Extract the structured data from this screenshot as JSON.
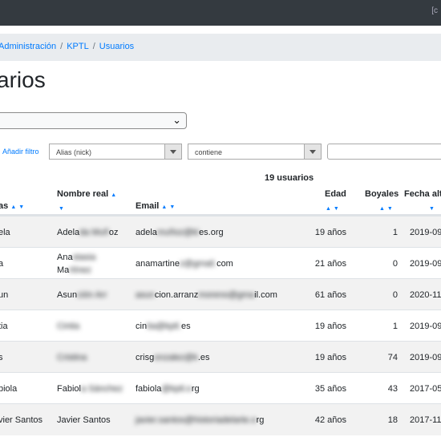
{
  "topbar": {
    "tray_text": "[c"
  },
  "breadcrumb": {
    "items": [
      "Administración",
      "KPTL",
      "Usuarios"
    ],
    "separator": "/"
  },
  "page": {
    "title": "arios"
  },
  "filters": {
    "add_filter_label": "Añadir filtro",
    "field_select": "Alias (nick)",
    "operator_select": "contiene",
    "value_input": ""
  },
  "results": {
    "count_label": "19 usuarios"
  },
  "table": {
    "headers": {
      "alias": "as",
      "nombre": "Nombre real",
      "email": "Email",
      "edad": "Edad",
      "boyales": "Boyales",
      "fecha": "Fecha alt"
    },
    "rows": [
      {
        "alias": "ela",
        "nombre": "Adela",
        "nombre2": "",
        "email": "adela",
        "email_end": "es.org",
        "edad": "19 años",
        "boyales": "1",
        "fecha": "2019-09"
      },
      {
        "alias": "a",
        "nombre": "Ana",
        "nombre2": "Ma",
        "email": "anamartine",
        "email_end": "com",
        "edad": "21 años",
        "boyales": "0",
        "fecha": "2019-09"
      },
      {
        "alias": "un",
        "nombre": "Asun",
        "nombre2": "",
        "email": "",
        "email_end": "il.com",
        "edad": "61 años",
        "boyales": "0",
        "fecha": "2020-11"
      },
      {
        "alias": "tia",
        "nombre": "",
        "nombre2": "",
        "email": "cin",
        "email_end": "es",
        "edad": "19 años",
        "boyales": "1",
        "fecha": "2019-09"
      },
      {
        "alias": "s",
        "nombre": "",
        "nombre2": "",
        "email": "crisg",
        "email_end": ".es",
        "edad": "19 años",
        "boyales": "74",
        "fecha": "2019-09"
      },
      {
        "alias": "biola",
        "nombre": "Fabiol",
        "nombre2": "",
        "email": "fabiola",
        "email_end": "rg",
        "edad": "35 años",
        "boyales": "43",
        "fecha": "2017-05"
      },
      {
        "alias": "vier Santos",
        "nombre": "Javier Santos",
        "nombre2": "",
        "email": "",
        "email_end": "rg",
        "edad": "42 años",
        "boyales": "18",
        "fecha": "2017-11"
      }
    ]
  },
  "colors": {
    "link": "#007bff",
    "topbar": "#343a40",
    "stripe": "#f2f2f2"
  }
}
